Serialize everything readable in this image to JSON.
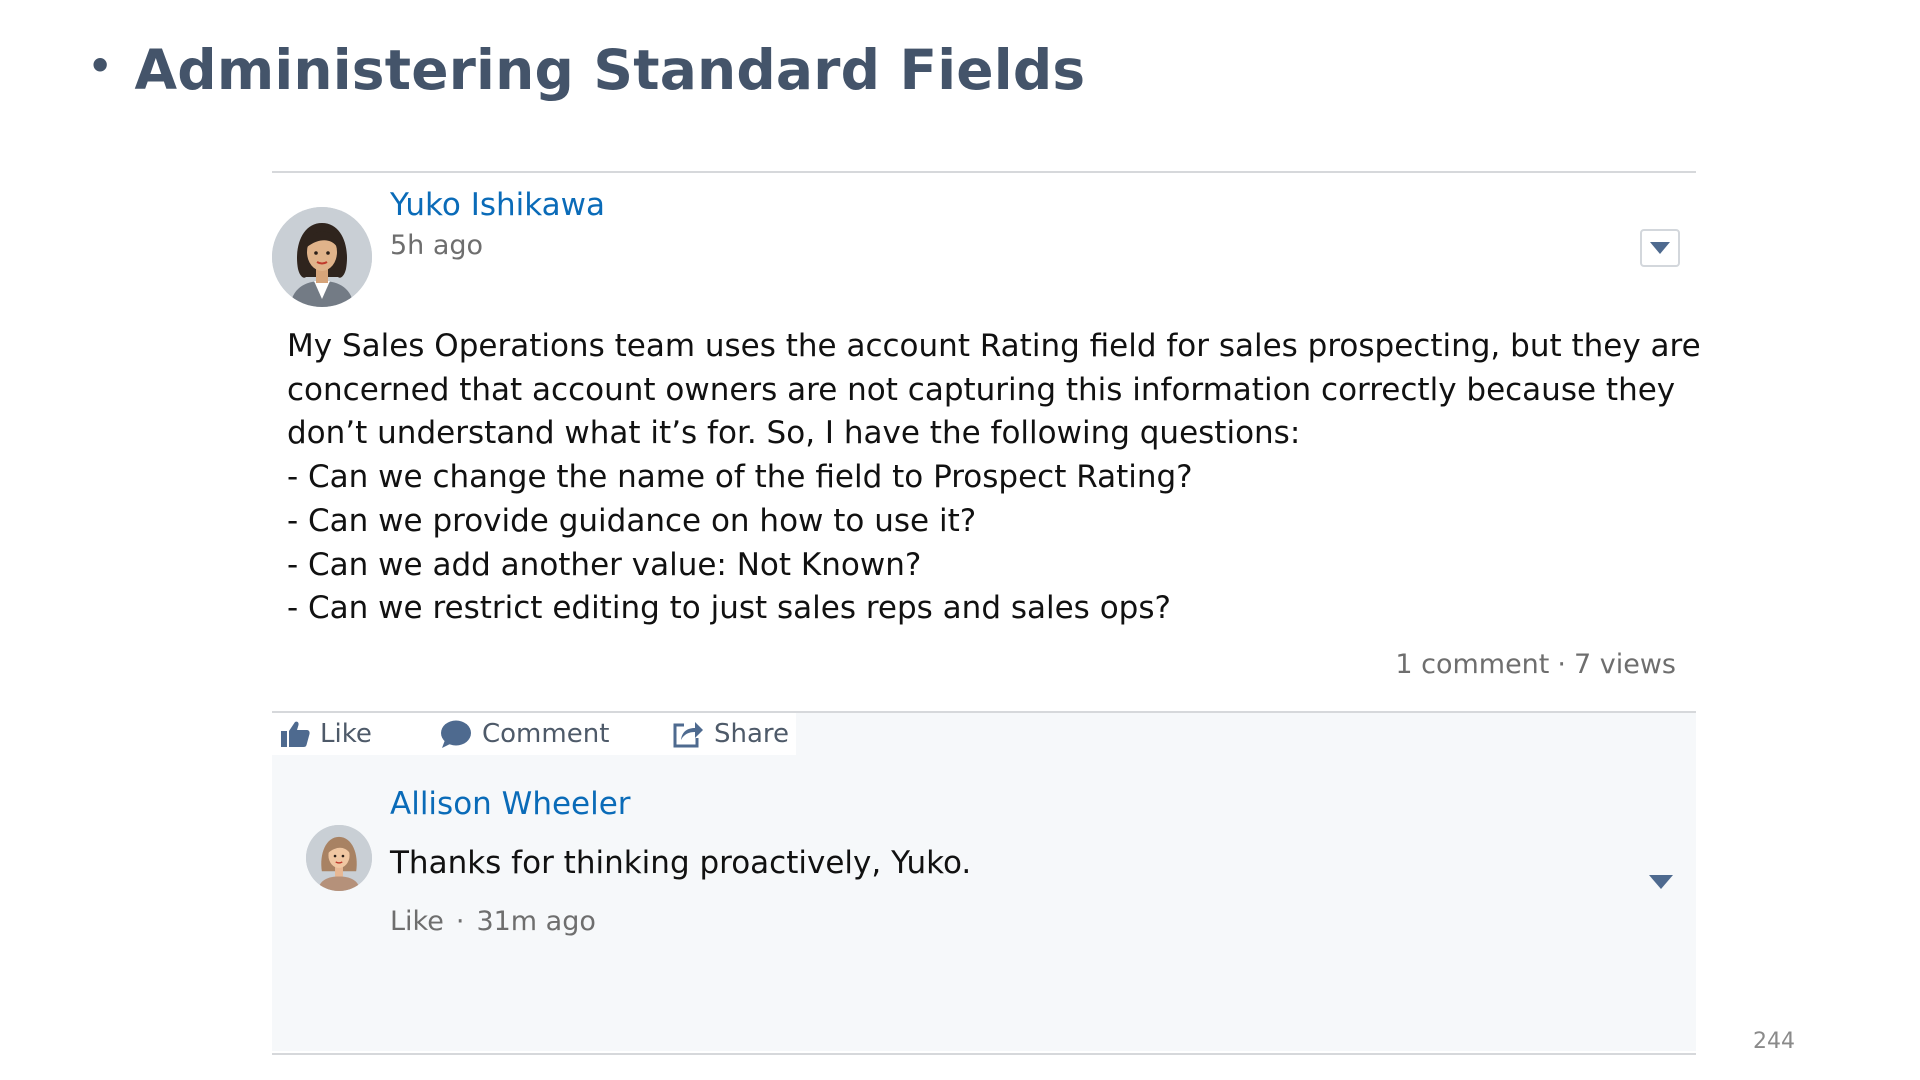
{
  "slide": {
    "bullet": "•",
    "title": "Administering Standard Fields",
    "page_number": "244"
  },
  "post": {
    "author": "Yuko Ishikawa",
    "time": "5h ago",
    "body_lines": [
      "My Sales Operations team uses the account Rating field for sales prospecting, but they are",
      "concerned that account owners are not capturing this information correctly because they",
      "don’t understand what it’s for. So, I have the following questions:",
      "- Can we change the name of the field to Prospect Rating?",
      "- Can we provide guidance on how to use it?",
      "- Can we add another value: Not Known?",
      "- Can we restrict editing to just sales reps and sales ops?"
    ],
    "comments_count": "1 comment",
    "stats_separator": "·",
    "views_count": "7 views",
    "dropdown_icon": "chevron-down-icon"
  },
  "actions": {
    "like_label": "Like",
    "comment_label": "Comment",
    "share_label": "Share",
    "like_icon": "thumbs-up-icon",
    "comment_icon": "speech-bubble-icon",
    "share_icon": "share-icon"
  },
  "comment": {
    "author": "Allison Wheeler",
    "text": "Thanks for thinking proactively, Yuko.",
    "like_label": "Like",
    "separator": "·",
    "time": "31m ago"
  },
  "colors": {
    "title": "#44546a",
    "link": "#0a6bb8",
    "icon": "#4e6a8f",
    "action_text": "#4e5a69",
    "muted": "#6e6e6e",
    "comment_bg": "#f6f8fa"
  }
}
